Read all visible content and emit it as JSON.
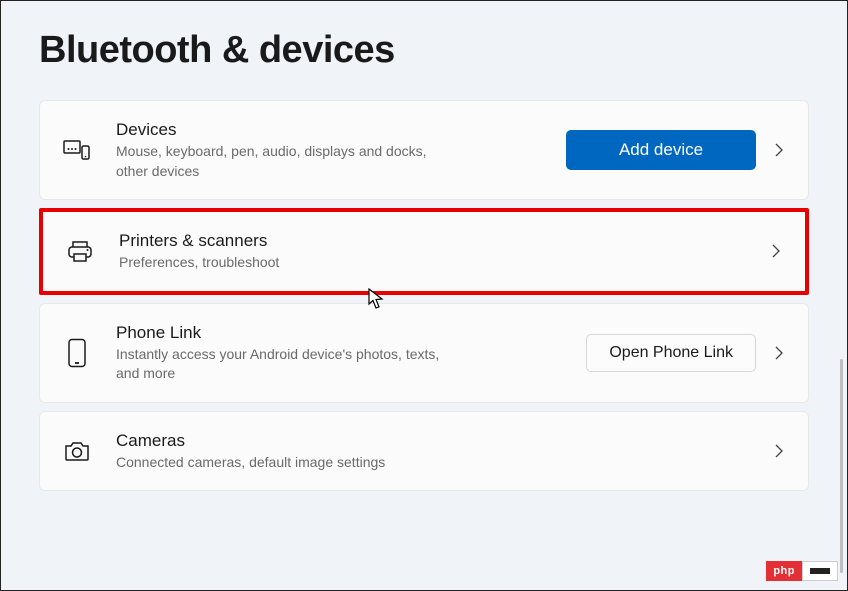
{
  "page": {
    "title": "Bluetooth & devices"
  },
  "rows": {
    "devices": {
      "title": "Devices",
      "subtitle": "Mouse, keyboard, pen, audio, displays and docks, other devices",
      "action": "Add device"
    },
    "printers": {
      "title": "Printers & scanners",
      "subtitle": "Preferences, troubleshoot"
    },
    "phone": {
      "title": "Phone Link",
      "subtitle": "Instantly access your Android device's photos, texts, and more",
      "action": "Open Phone Link"
    },
    "cameras": {
      "title": "Cameras",
      "subtitle": "Connected cameras, default image settings"
    }
  },
  "watermark": {
    "left": "php"
  }
}
